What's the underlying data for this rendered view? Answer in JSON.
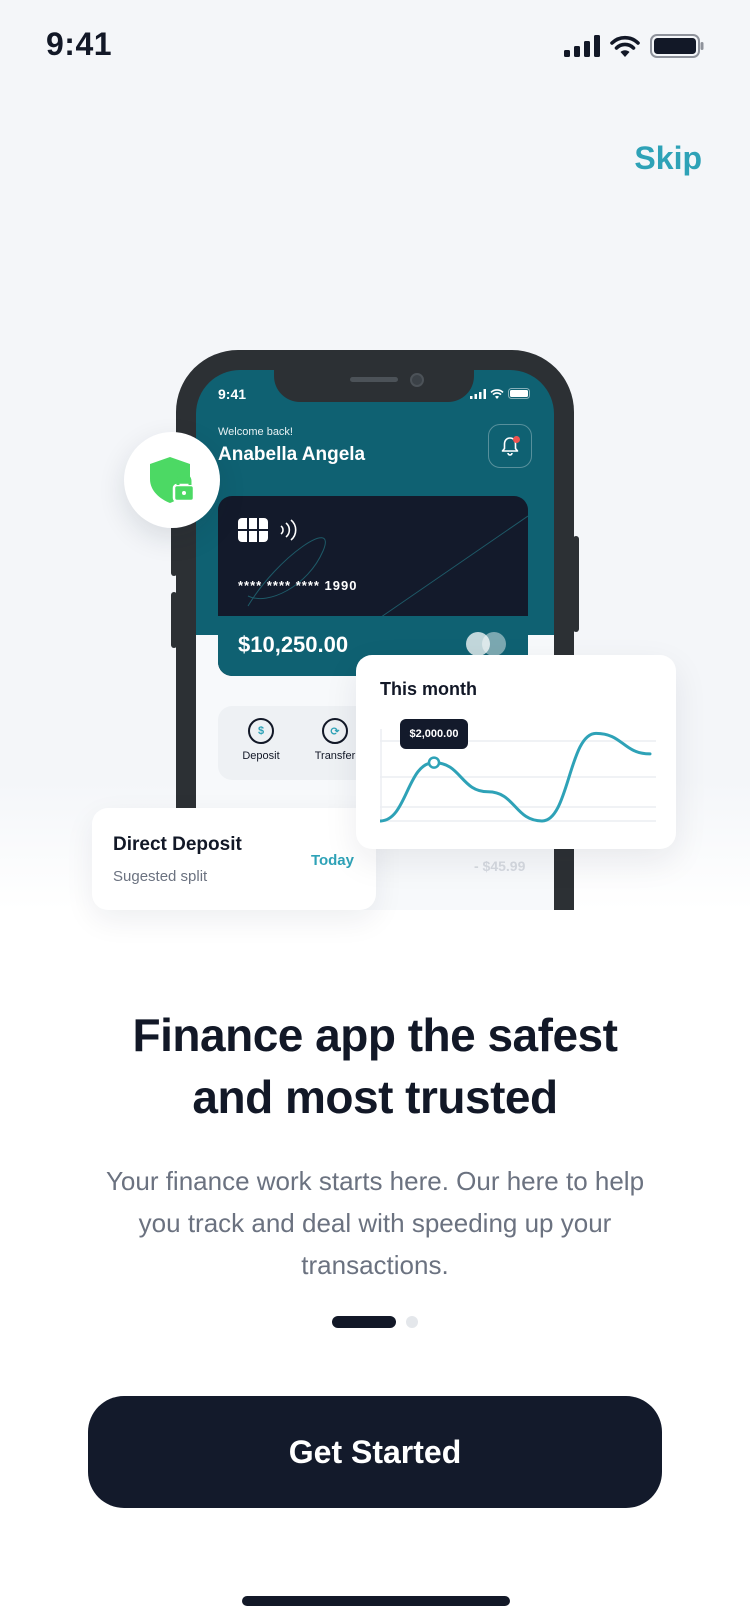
{
  "status_bar": {
    "time": "9:41"
  },
  "header": {
    "skip_label": "Skip"
  },
  "phone_preview": {
    "time": "9:41",
    "welcome": "Welcome back!",
    "user_name": "Anabella Angela",
    "card": {
      "number_masked": "**** **** **** 1990",
      "balance": "$10,250.00"
    },
    "actions": [
      {
        "label": "Deposit"
      },
      {
        "label": "Transfer"
      }
    ],
    "faded_amount": "- $45.99"
  },
  "deposit_card": {
    "title": "Direct Deposit",
    "subtitle": "Sugested split",
    "when": "Today"
  },
  "chart_card": {
    "title": "This month"
  },
  "chart_data": {
    "type": "line",
    "title": "This month",
    "series": [
      {
        "values": [
          0,
          2000,
          1000,
          0.4,
          3000,
          2300
        ]
      }
    ],
    "highlight": {
      "index": 1,
      "label": "$2,000.00"
    },
    "grid": true,
    "color": "#2ea2b7"
  },
  "onboarding": {
    "headline_line1": "Finance app the safest",
    "headline_line2": "and most trusted",
    "body": "Your finance work starts here. Our here to help you track and deal with speeding up your transactions.",
    "page_index": 0,
    "page_count": 2
  },
  "cta": {
    "label": "Get Started"
  },
  "colors": {
    "accent": "#2ea2b7",
    "dark": "#121827",
    "teal": "#0f6172",
    "success": "#4cd964"
  }
}
